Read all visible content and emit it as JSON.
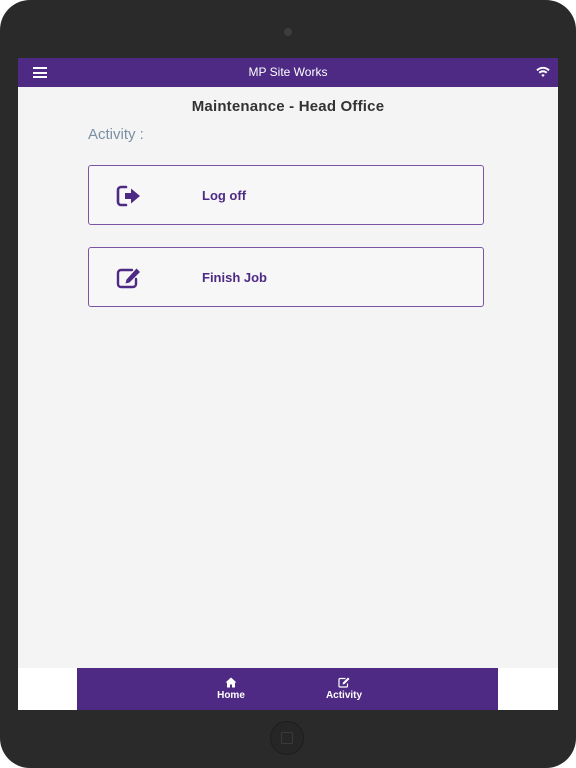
{
  "app": {
    "title": "MP Site Works"
  },
  "page": {
    "title": "Maintenance - Head Office",
    "section_label": "Activity :"
  },
  "actions": [
    {
      "label": "Log off",
      "icon": "sign-out-icon"
    },
    {
      "label": "Finish Job",
      "icon": "edit-icon"
    }
  ],
  "tabbar": {
    "tabs": [
      {
        "label": "Home",
        "icon": "home-icon"
      },
      {
        "label": "Activity",
        "icon": "edit-icon"
      }
    ]
  },
  "colors": {
    "brand": "#4e2a84",
    "label": "#7a8fa6",
    "background": "#f4f4f4"
  }
}
